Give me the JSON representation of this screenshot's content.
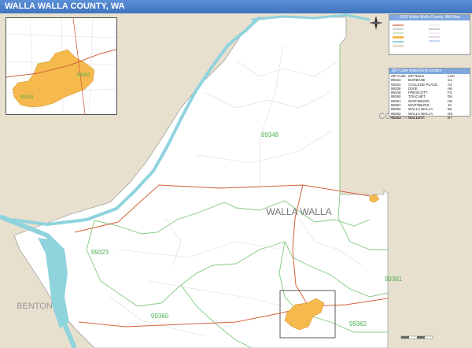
{
  "title": "WALLA WALLA COUNTY, WA",
  "county_label": "WALLA WALLA",
  "neighbor_labels": [
    "BENTON",
    "COLUMBIA"
  ],
  "zip_labels": [
    "99348",
    "99323",
    "99361",
    "99360",
    "99362"
  ],
  "inset_zip_labels": [
    "99362",
    "99324"
  ],
  "legend": {
    "title": "2016 Walla Walla County, WA Map"
  },
  "zip_table": {
    "title": "ZIP Code Index/Grid Locator",
    "columns": [
      "ZIP Code",
      "ZIP Name",
      "LOC"
    ],
    "rows": [
      [
        "99323",
        "BURBANK",
        "C1"
      ],
      [
        "99324",
        "COLLEGE PLACE",
        "A3"
      ],
      [
        "99328",
        "DIXIE",
        "H6"
      ],
      [
        "99348",
        "PRESCOTT",
        "F3"
      ],
      [
        "99360",
        "TOUCHET",
        "D6"
      ],
      [
        "99361",
        "WAITSBURG",
        "H5"
      ],
      [
        "99361",
        "WAITSBURG",
        "J2"
      ],
      [
        "99362",
        "WALLA WALLA",
        "B2"
      ],
      [
        "99362",
        "WALLA WALLA",
        "G6"
      ],
      [
        "99363",
        "WALLULA",
        "B7"
      ]
    ]
  },
  "colors": {
    "water": "#8fd3dd",
    "outside": "#e8e0cf",
    "county": "#ffffff",
    "urban": "#f5b94e",
    "zip_line": "#7fc97f",
    "highway": "#d4623b",
    "title_bar": "#4a80cc"
  },
  "icons": [
    "compass-rose-icon"
  ]
}
